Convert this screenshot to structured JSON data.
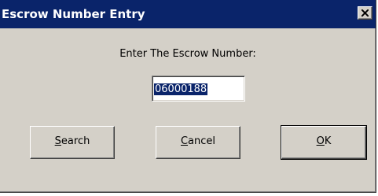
{
  "window": {
    "title": "Escrow Number Entry",
    "close_glyph": "×",
    "colors": {
      "titlebar": "#0a246a",
      "face": "#d4d0c8",
      "selection": "#0a246a"
    }
  },
  "prompt": {
    "text": "Enter The Escrow Number:"
  },
  "escrow_input": {
    "value": "06000188",
    "selected": true
  },
  "buttons": {
    "search": {
      "mnemonic": "S",
      "rest": "earch"
    },
    "cancel": {
      "mnemonic": "C",
      "rest": "ancel"
    },
    "ok": {
      "mnemonic": "O",
      "rest": "K",
      "default": true
    }
  }
}
